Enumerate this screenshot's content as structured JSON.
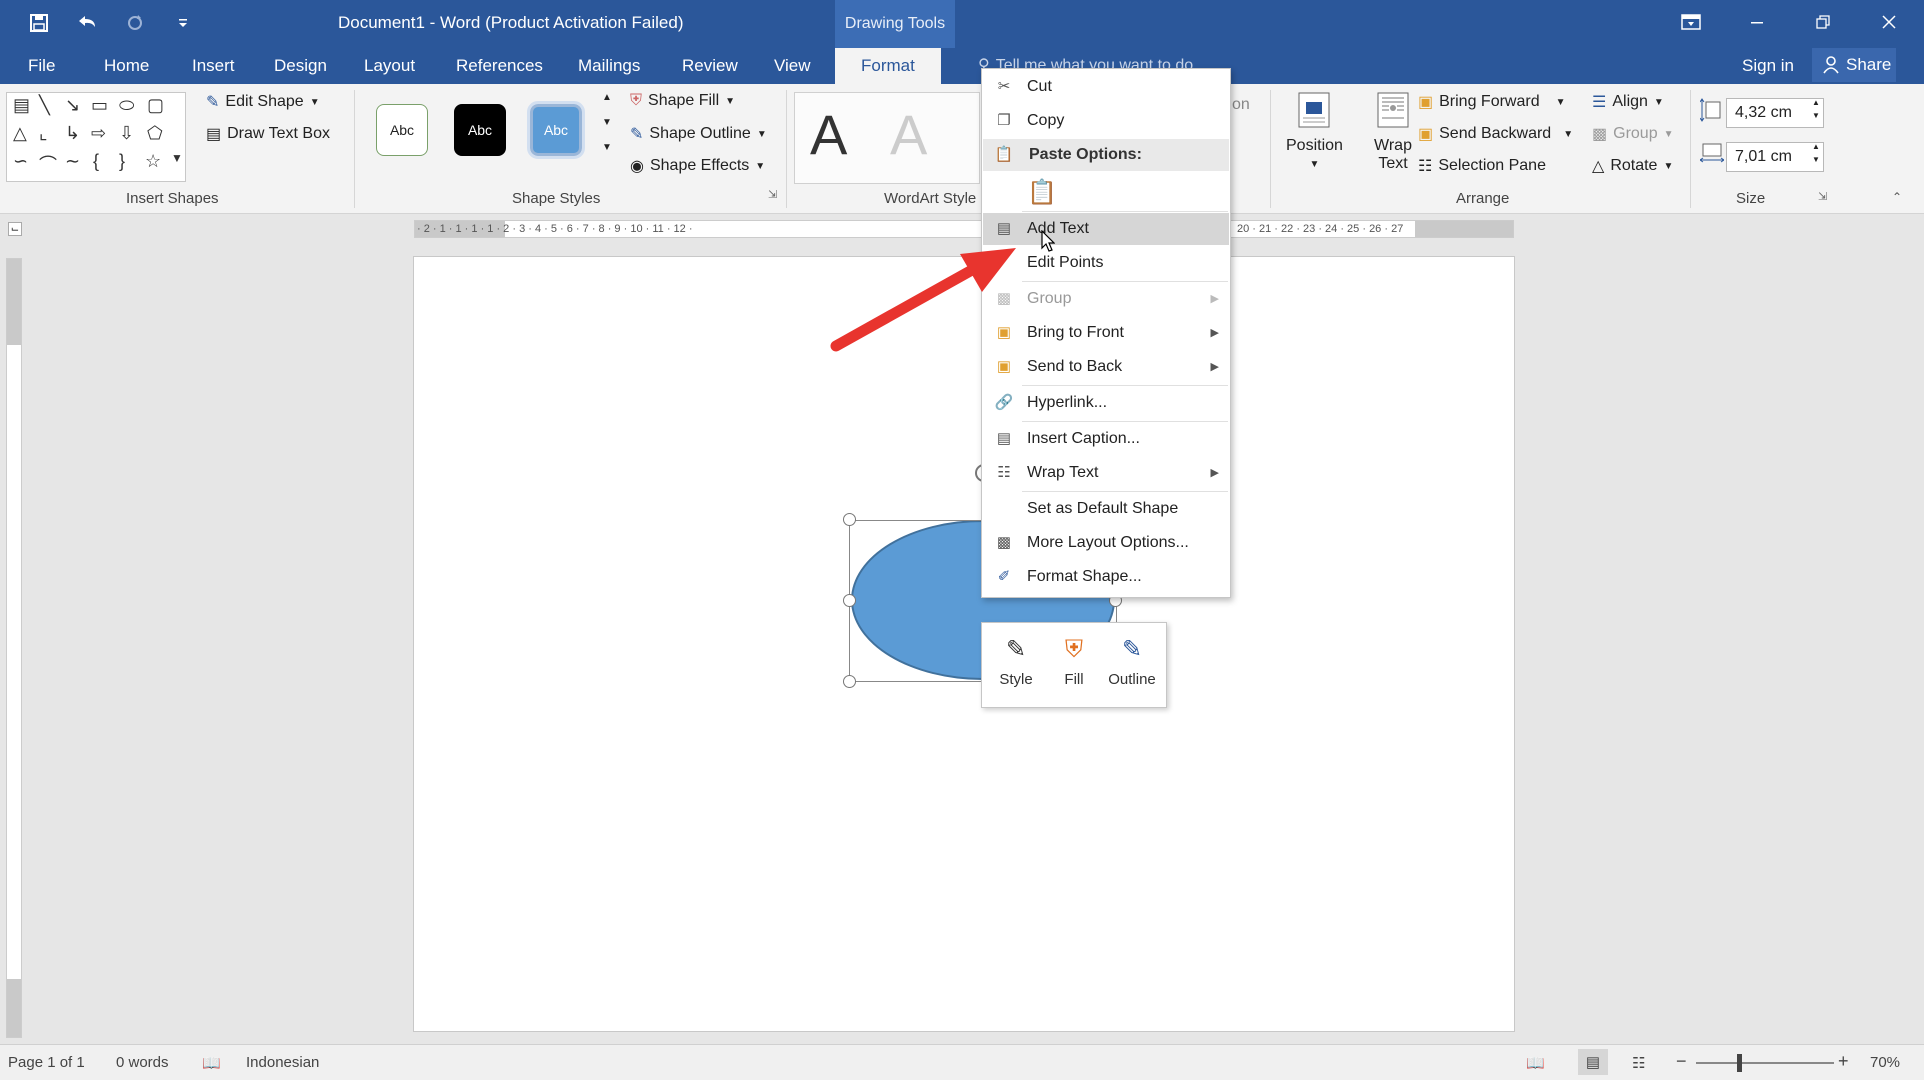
{
  "titlebar": {
    "doc_title": "Document1 - Word (Product Activation Failed)",
    "context_tab": "Drawing Tools"
  },
  "tabs": {
    "file": "File",
    "home": "Home",
    "insert": "Insert",
    "design": "Design",
    "layout": "Layout",
    "references": "References",
    "mailings": "Mailings",
    "review": "Review",
    "view": "View",
    "format": "Format",
    "tellme": "Tell me what you want to do",
    "signin": "Sign in",
    "share": "Share"
  },
  "ribbon": {
    "insert_shapes": {
      "label": "Insert Shapes",
      "edit_shape": "Edit Shape",
      "draw_text_box": "Draw Text Box"
    },
    "shape_styles": {
      "label": "Shape Styles",
      "thumb": "Abc",
      "shape_fill": "Shape Fill",
      "shape_outline": "Shape Outline",
      "shape_effects": "Shape Effects"
    },
    "wordart": {
      "label": "WordArt Style",
      "letter": "A"
    },
    "arrange": {
      "label": "Arrange",
      "position": "Position",
      "wrap_text": "Wrap Text",
      "bring_forward": "Bring Forward",
      "send_backward": "Send Backward",
      "selection_pane": "Selection Pane",
      "align": "Align",
      "group": "Group",
      "rotate": "Rotate",
      "partial": "on"
    },
    "size": {
      "label": "Size",
      "height": "4,32 cm",
      "width": "7,01 cm"
    }
  },
  "ruler_text": "· 2 · 1 · 1 · 1 · 1 · 2 · 3 · 4 · 5 · 6 · 7 · 8 · 9 · 10 · 11 · 12 ·",
  "ruler_text_right": "20 · 21 · 22 · 23 · 24 · 25 · 26 · 27",
  "context_menu": {
    "cut": "Cut",
    "copy": "Copy",
    "paste_options": "Paste Options:",
    "add_text": "Add Text",
    "edit_points": "Edit Points",
    "group": "Group",
    "bring_to_front": "Bring to Front",
    "send_to_back": "Send to Back",
    "hyperlink": "Hyperlink...",
    "insert_caption": "Insert Caption...",
    "wrap_text": "Wrap Text",
    "set_default": "Set as Default Shape",
    "more_layout": "More Layout Options...",
    "format_shape": "Format Shape..."
  },
  "mini_toolbar": {
    "style": "Style",
    "fill": "Fill",
    "outline": "Outline"
  },
  "statusbar": {
    "page": "Page 1 of 1",
    "words": "0 words",
    "language": "Indonesian",
    "zoom": "70%"
  },
  "colors": {
    "word_blue": "#2b579a",
    "shape_fill": "#5b9bd5",
    "arrow": "#e8342e"
  }
}
